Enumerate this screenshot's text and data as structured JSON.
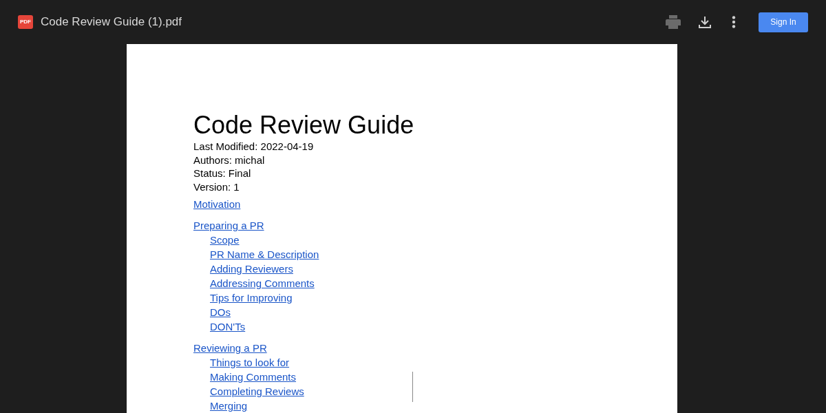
{
  "toolbar": {
    "file_badge": "PDF",
    "file_name": "Code Review Guide (1).pdf",
    "sign_in": "Sign In"
  },
  "document": {
    "title": "Code Review Guide",
    "meta": [
      "Last Modified: 2022-04-19",
      "Authors: michal",
      "Status: Final",
      "Version: 1"
    ],
    "toc": [
      {
        "label": "Motivation"
      },
      {
        "label": "Preparing a PR",
        "children": [
          {
            "label": "Scope"
          },
          {
            "label": "PR Name & Description"
          },
          {
            "label": "Adding Reviewers"
          },
          {
            "label": "Addressing Comments"
          },
          {
            "label": "Tips for Improving"
          },
          {
            "label": "DOs"
          },
          {
            "label": "DON'Ts"
          }
        ]
      },
      {
        "label": "Reviewing a PR",
        "children": [
          {
            "label": "Things to look for"
          },
          {
            "label": "Making Comments"
          },
          {
            "label": "Completing Reviews"
          },
          {
            "label": "Merging"
          }
        ]
      }
    ]
  }
}
